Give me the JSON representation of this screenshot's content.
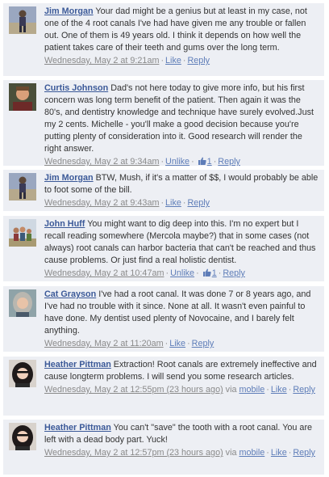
{
  "comments": [
    {
      "author": "Jim Morgan",
      "text": "Your dad might be a genius but at least in my case, not one of the 4 root canals I've had have given me any trouble or fallen out. One of them is 49 years old. I think it depends on how well the patient takes care of their teeth and gums over the long term.",
      "timestamp": "Wednesday, May 2 at 9:21am",
      "like_label": "Like",
      "reply_label": "Reply",
      "avatar": "avatar-jim-morgan"
    },
    {
      "author": "Curtis Johnson",
      "text": "Dad's not here today to give more info, but his first concern was long term benefit of the patient. Then again it was the 80's, and dentistry knowledge and technique have surely evolved.Just my 2 cents. Michelle - you'll make a good decision because you're putting plenty of consideration into it. Good research will render the right answer.",
      "timestamp": "Wednesday, May 2 at 9:34am",
      "like_label": "Unlike",
      "like_count": "1",
      "reply_label": "Reply",
      "avatar": "avatar-curtis-johnson"
    },
    {
      "author": "Jim Morgan",
      "text": "BTW, Mush, if it's a matter of $$, I would probably be able to foot some of the bill.",
      "timestamp": "Wednesday, May 2 at 9:43am",
      "like_label": "Like",
      "reply_label": "Reply",
      "avatar": "avatar-jim-morgan"
    },
    {
      "author": "John Huff",
      "text": "You might want to dig deep into this. I'm no expert but I recall reading somewhere (Mercola maybe?) that in some cases (not always) root canals can harbor bacteria that can't be reached and thus cause problems. Or just find a real holistic dentist.",
      "timestamp": "Wednesday, May 2 at 10:47am",
      "like_label": "Unlike",
      "like_count": "1",
      "reply_label": "Reply",
      "avatar": "avatar-john-huff"
    },
    {
      "author": "Cat Grayson",
      "text": "I've had a root canal. It was done 7 or 8 years ago, and I've had no trouble with it since. None at all. It wasn't even painful to have done. My dentist used plenty of Novocaine, and I barely felt anything.",
      "timestamp": "Wednesday, May 2 at 11:20am",
      "like_label": "Like",
      "reply_label": "Reply",
      "avatar": "avatar-cat-grayson"
    },
    {
      "author": "Heather Pittman",
      "text": "Extraction! Root canals are extremely ineffective and cause longterm problems. I will send you some research articles.",
      "timestamp": "Wednesday, May 2 at 12:55pm (23 hours ago)",
      "via_label": "via",
      "via_source": "mobile",
      "like_label": "Like",
      "reply_label": "Reply",
      "avatar": "avatar-heather-pittman"
    },
    {
      "author": "Heather Pittman",
      "text": "You can't \"save\" the tooth with a root canal. You are left with a dead body part. Yuck!",
      "timestamp": "Wednesday, May 2 at 12:57pm (23 hours ago)",
      "via_label": "via",
      "via_source": "mobile",
      "like_label": "Like",
      "reply_label": "Reply",
      "avatar": "avatar-heather-pittman"
    }
  ],
  "colors": {
    "comment_bg": "#edeff4",
    "author_link": "#3b5998",
    "action_link": "#5e7db8",
    "meta_text": "#8a8a8a"
  }
}
